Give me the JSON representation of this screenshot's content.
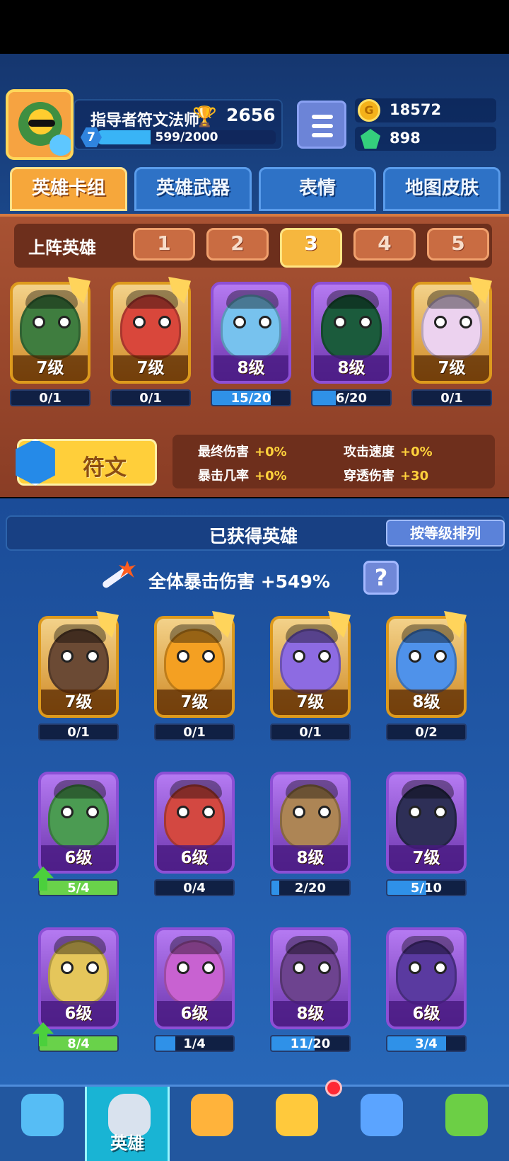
{
  "player": {
    "name": "指导者符文法师",
    "level": "7",
    "xp_text": "599/2000",
    "xp_progress": 0.2995,
    "trophies": "2656"
  },
  "currency": {
    "gold": "18572",
    "gems": "898"
  },
  "tabs": [
    "英雄卡组",
    "英雄武器",
    "表情",
    "地图皮肤"
  ],
  "lineup": {
    "title": "上阵英雄",
    "slots": [
      "1",
      "2",
      "3",
      "4",
      "5"
    ],
    "active_slot": "3"
  },
  "deck_cards": [
    {
      "level": "7级",
      "progress": "0/1",
      "fill": 0.0,
      "rarity": "gold",
      "color": "#3f7d3f",
      "icon": "frog-pirate-hero"
    },
    {
      "level": "7级",
      "progress": "0/1",
      "fill": 0.0,
      "rarity": "gold",
      "color": "#d9473b",
      "icon": "red-mage-hero"
    },
    {
      "level": "8级",
      "progress": "15/20",
      "fill": 0.75,
      "rarity": "purple",
      "color": "#77c2ee",
      "icon": "blue-wizard-hero"
    },
    {
      "level": "8级",
      "progress": "6/20",
      "fill": 0.3,
      "rarity": "purple",
      "color": "#1b5b3c",
      "icon": "green-hat-hero"
    },
    {
      "level": "7级",
      "progress": "0/1",
      "fill": 0.0,
      "rarity": "gold",
      "color": "#ecd2ef",
      "icon": "skull-reaper-hero"
    }
  ],
  "rune": {
    "label": "符文"
  },
  "stats": [
    {
      "name": "最终伤害",
      "bonus": "+0%"
    },
    {
      "name": "攻击速度",
      "bonus": "+0%"
    },
    {
      "name": "暴击几率",
      "bonus": "+0%"
    },
    {
      "name": "穿透伤害",
      "bonus": "+30"
    }
  ],
  "owned": {
    "title": "已获得英雄",
    "sort_label": "按等级排列",
    "crit_label": "全体暴击伤害 +549%",
    "help_label": "?"
  },
  "owned_cards": [
    {
      "level": "7级",
      "progress": "0/1",
      "fill": 0.0,
      "rarity": "gold",
      "color": "#6b4a34",
      "icon": "lava-golem-hero",
      "upgradeable": false
    },
    {
      "level": "7级",
      "progress": "0/1",
      "fill": 0.0,
      "rarity": "gold",
      "color": "#f4a022",
      "icon": "bomb-hero",
      "upgradeable": false
    },
    {
      "level": "7级",
      "progress": "0/1",
      "fill": 0.0,
      "rarity": "gold",
      "color": "#8d6be2",
      "icon": "octopus-hero",
      "upgradeable": false
    },
    {
      "level": "8级",
      "progress": "0/2",
      "fill": 0.0,
      "rarity": "gold",
      "color": "#4f92ea",
      "icon": "ice-girl-hero",
      "upgradeable": false
    },
    {
      "level": "6级",
      "progress": "5/4",
      "fill": 1.0,
      "rarity": "purple",
      "color": "#4b9b52",
      "icon": "robot-hero",
      "upgradeable": true
    },
    {
      "level": "6级",
      "progress": "0/4",
      "fill": 0.0,
      "rarity": "purple",
      "color": "#d34841",
      "icon": "ninja-hero",
      "upgradeable": false
    },
    {
      "level": "8级",
      "progress": "2/20",
      "fill": 0.1,
      "rarity": "purple",
      "color": "#ad8555",
      "icon": "hooded-hero",
      "upgradeable": false
    },
    {
      "level": "7级",
      "progress": "5/10",
      "fill": 0.5,
      "rarity": "purple",
      "color": "#2e2f57",
      "icon": "thief-hero",
      "upgradeable": false
    },
    {
      "level": "6级",
      "progress": "8/4",
      "fill": 1.0,
      "rarity": "purple",
      "color": "#e5c65b",
      "icon": "astronaut-hero",
      "upgradeable": true
    },
    {
      "level": "6级",
      "progress": "1/4",
      "fill": 0.25,
      "rarity": "purple",
      "color": "#c862d1",
      "icon": "princess-hero",
      "upgradeable": false
    },
    {
      "level": "8级",
      "progress": "11/20",
      "fill": 0.55,
      "rarity": "purple",
      "color": "#6d438f",
      "icon": "magician-hero",
      "upgradeable": false
    },
    {
      "level": "6级",
      "progress": "3/4",
      "fill": 0.75,
      "rarity": "purple",
      "color": "#5a3aa0",
      "icon": "police-hero",
      "upgradeable": false
    }
  ],
  "bottom_nav": [
    {
      "icon": "treasure-chest-icon",
      "label": ""
    },
    {
      "icon": "knight-helmet-icon",
      "label": "英雄"
    },
    {
      "icon": "crossed-swords-icon",
      "label": ""
    },
    {
      "icon": "crown-shield-icon",
      "label": ""
    },
    {
      "icon": "team-banner-icon",
      "label": ""
    },
    {
      "icon": "sprout-island-icon",
      "label": ""
    }
  ]
}
